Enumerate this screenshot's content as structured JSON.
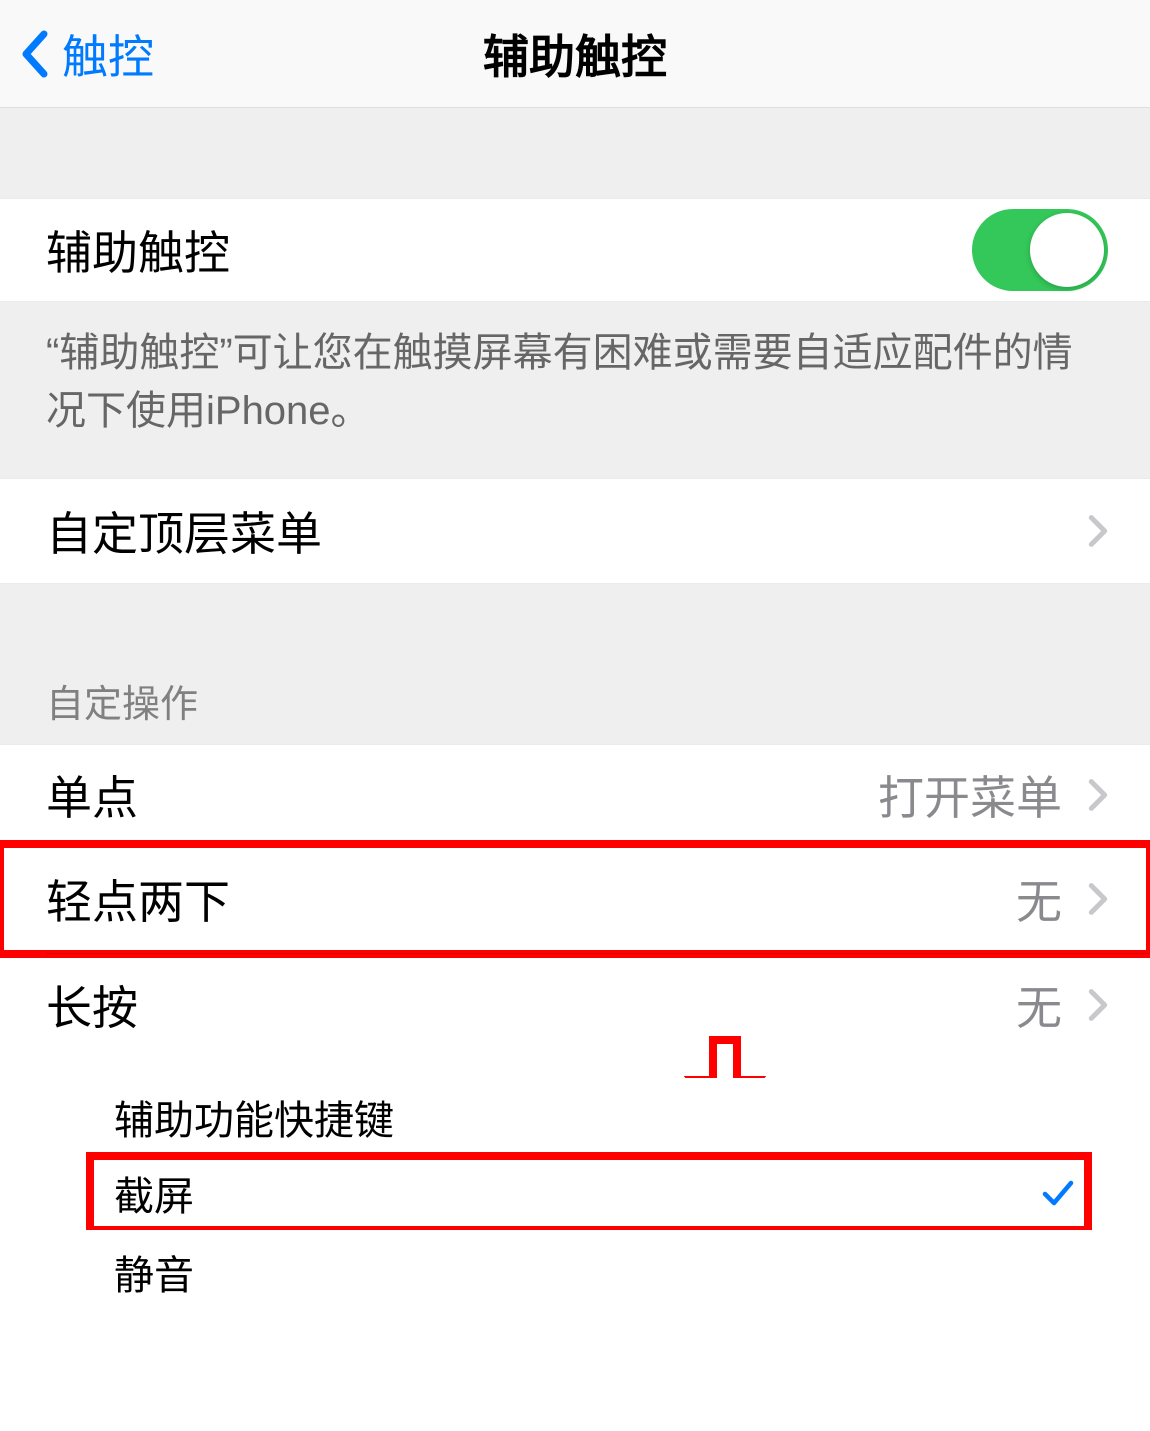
{
  "nav": {
    "back_label": "触控",
    "title": "辅助触控"
  },
  "toggle_row": {
    "label": "辅助触控",
    "enabled": true,
    "footer": "“辅助触控”可让您在触摸屏幕有困难或需要自适应配件的情况下使用iPhone。"
  },
  "menu_row": {
    "label": "自定顶层菜单"
  },
  "custom_actions": {
    "header": "自定操作",
    "single_tap": {
      "label": "单点",
      "value": "打开菜单"
    },
    "double_tap": {
      "label": "轻点两下",
      "value": "无"
    },
    "long_press": {
      "label": "长按",
      "value": "无"
    }
  },
  "submenu": {
    "shortcut": {
      "label": "辅助功能快捷键"
    },
    "screenshot": {
      "label": "截屏",
      "checked": true
    },
    "mute": {
      "label": "静音"
    }
  },
  "colors": {
    "ios_blue": "#007aff",
    "ios_green": "#34c759",
    "highlight": "#ff0000"
  }
}
